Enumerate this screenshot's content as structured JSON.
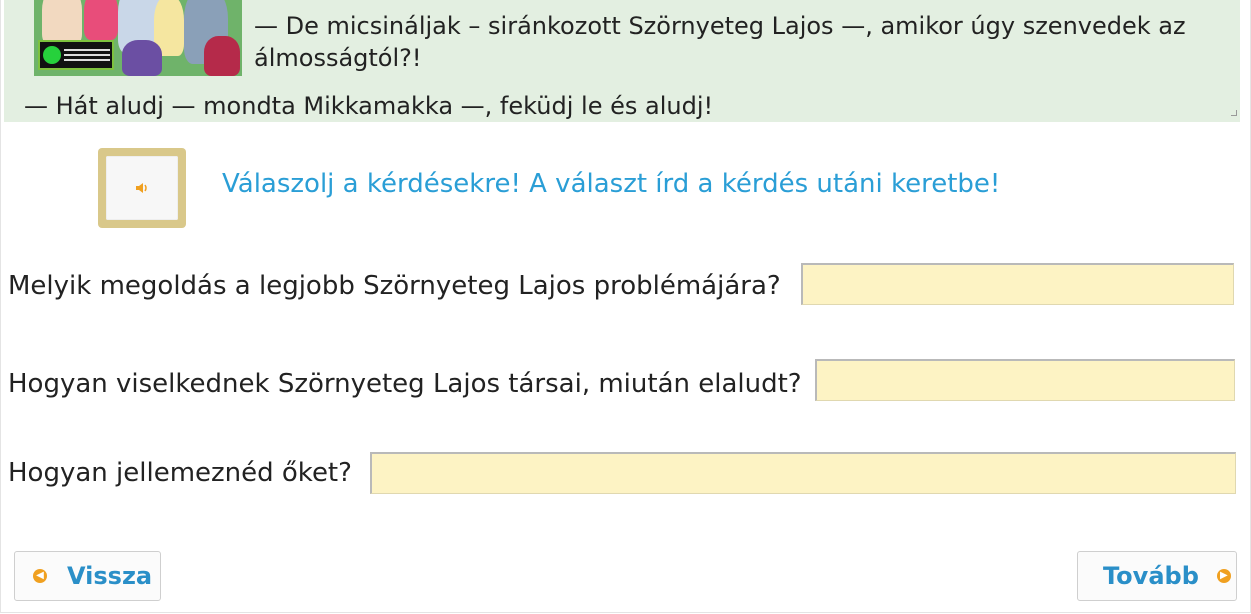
{
  "story": {
    "line1": "—  De micsináljak – siránkozott Szörnyeteg Lajos —, amikor úgy szenvedek az",
    "line2": "álmosságtól?!",
    "line3": "—  Hát aludj — mondta Mikkamakka —, feküdj le és aludj!"
  },
  "audio": {
    "icon": "speaker-icon"
  },
  "instruction": "Válaszolj a kérdésekre! A választ írd a kérdés utáni keretbe!",
  "questions": [
    {
      "label": "Melyik megoldás a legjobb Szörnyeteg Lajos problémájára?",
      "value": ""
    },
    {
      "label": "Hogyan viselkednek Szörnyeteg Lajos társai, miután elaludt?",
      "value": ""
    },
    {
      "label": "Hogyan jellemeznéd őket?",
      "value": ""
    }
  ],
  "nav": {
    "back_label": "Vissza",
    "next_label": "Tovább"
  },
  "colors": {
    "story_bg": "#e3efe1",
    "instruction": "#2a9ed6",
    "answer_bg": "#fdf3c4",
    "nav_text": "#2a8fc8",
    "nav_arrow": "#f0a020",
    "audio_frame": "#d9c88a"
  }
}
